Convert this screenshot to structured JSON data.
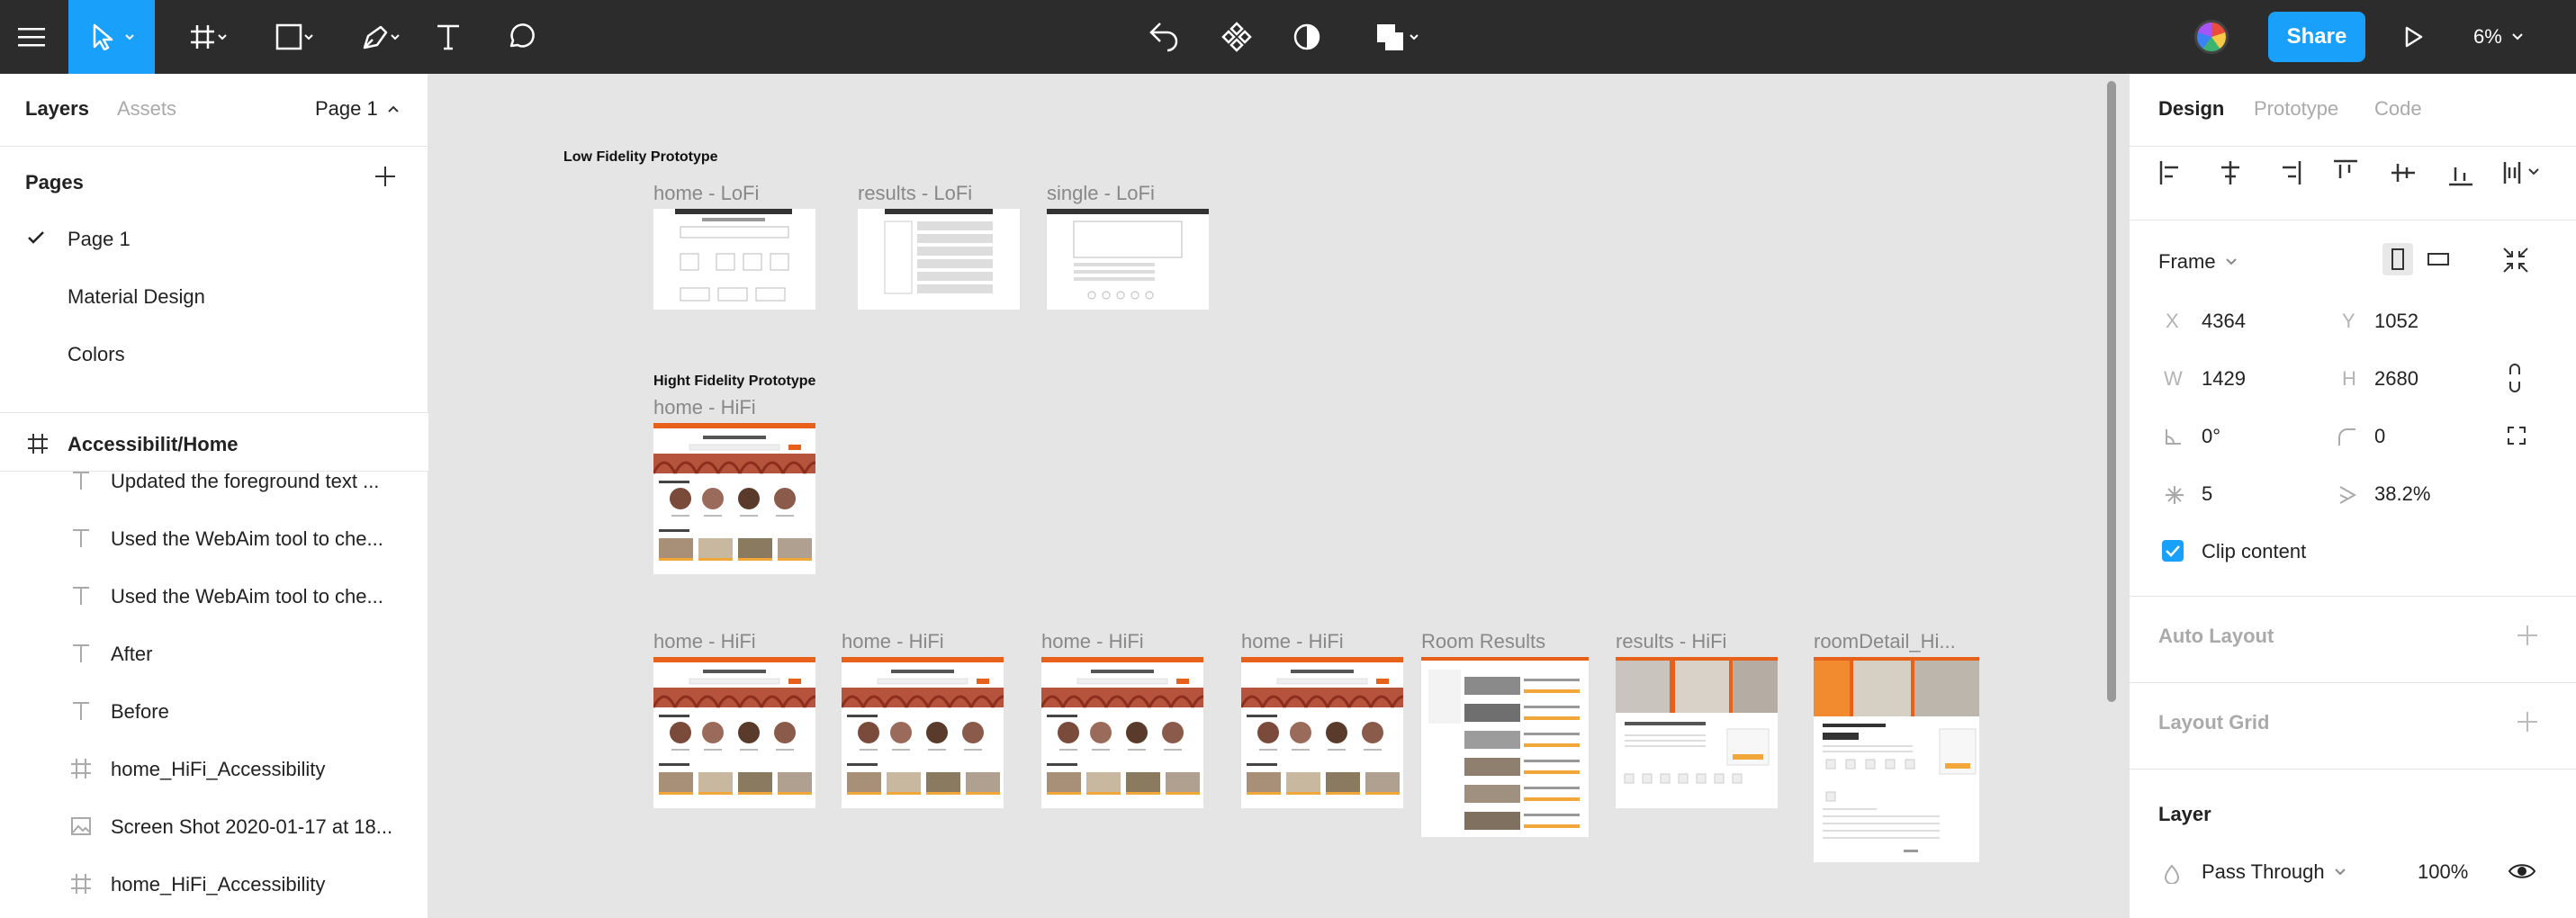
{
  "toolbar": {
    "share_label": "Share",
    "zoom": "6%"
  },
  "left_panel": {
    "tabs": {
      "layers": "Layers",
      "assets": "Assets"
    },
    "current_page": "Page 1",
    "pages_heading": "Pages",
    "pages": [
      "Page 1",
      "Material Design",
      "Colors"
    ],
    "selected_frame": "Accessibilit/Home",
    "layers": [
      {
        "type": "text",
        "label": "Updated the foreground text ..."
      },
      {
        "type": "text",
        "label": "Used the WebAim tool to che..."
      },
      {
        "type": "text",
        "label": "Used the WebAim tool to che..."
      },
      {
        "type": "text",
        "label": "After"
      },
      {
        "type": "text",
        "label": "Before"
      },
      {
        "type": "frame",
        "label": "home_HiFi_Accessibility"
      },
      {
        "type": "image",
        "label": "Screen Shot 2020-01-17 at 18..."
      },
      {
        "type": "frame",
        "label": "home_HiFi_Accessibility"
      }
    ]
  },
  "canvas": {
    "sections": {
      "low": "Low Fidelity Prototype",
      "high": "Hight Fidelity Prototype"
    },
    "frames": {
      "lofi_home": "home - LoFi",
      "lofi_results": "results - LoFi",
      "lofi_single": "single - LoFi",
      "hifi_home_top": "home - HiFi",
      "hifi_home_1": "home - HiFi",
      "hifi_home_2": "home - HiFi",
      "hifi_home_3": "home - HiFi",
      "hifi_home_4": "home - HiFi",
      "room_results": "Room Results",
      "results_hifi": "results - HiFi",
      "room_detail": "roomDetail_Hi..."
    }
  },
  "right_panel": {
    "tabs": {
      "design": "Design",
      "prototype": "Prototype",
      "code": "Code"
    },
    "frame_label": "Frame",
    "props": {
      "x_label": "X",
      "x": "4364",
      "y_label": "Y",
      "y": "1052",
      "w_label": "W",
      "w": "1429",
      "h_label": "H",
      "h": "2680",
      "rotation": "0°",
      "radius": "0",
      "count": "5",
      "ratio": "38.2%"
    },
    "clip_content": "Clip content",
    "auto_layout": "Auto Layout",
    "layout_grid": "Layout Grid",
    "layer_heading": "Layer",
    "blend_mode": "Pass Through",
    "opacity": "100%"
  },
  "colors": {
    "accent": "#18a0fb",
    "toolbar_bg": "#2c2c2c",
    "hifi_orange": "#e8611a"
  }
}
